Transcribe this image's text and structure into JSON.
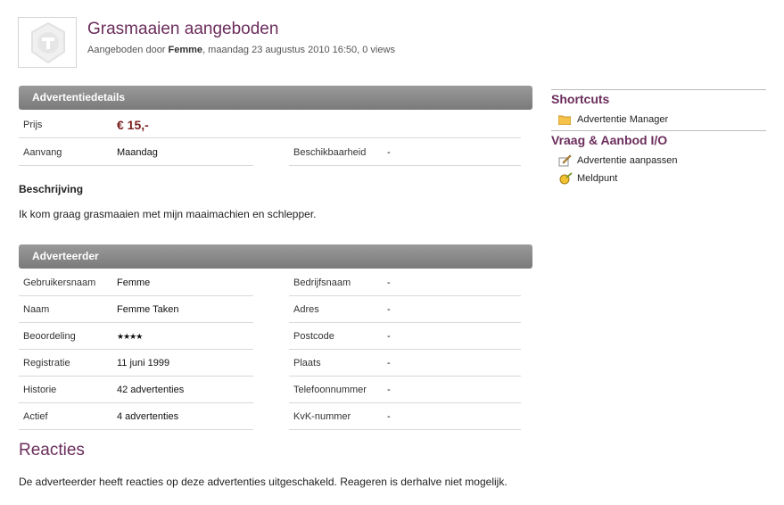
{
  "header": {
    "title": "Grasmaaien aangeboden",
    "subtitle_prefix": "Aangeboden door",
    "author": "Femme",
    "subtitle_suffix": ", maandag 23 augustus 2010 16:50, 0 views"
  },
  "details": {
    "bar_label": "Advertentiedetails",
    "prijs_label": "Prijs",
    "prijs_value": "€ 15,-",
    "aanvang_label": "Aanvang",
    "aanvang_value": "Maandag",
    "beschikbaar_label": "Beschikbaarheid",
    "beschikbaar_value": "-"
  },
  "beschrijving": {
    "heading": "Beschrijving",
    "text": "Ik kom graag grasmaaien met mijn maaimachien en schlepper."
  },
  "adverteerder": {
    "bar_label": "Adverteerder",
    "left": [
      {
        "label": "Gebruikersnaam",
        "value": "Femme",
        "link": true
      },
      {
        "label": "Naam",
        "value": "Femme Taken",
        "link": false
      },
      {
        "label": "Beoordeling",
        "value": "★★★★",
        "link": false,
        "stars": true
      },
      {
        "label": "Registratie",
        "value": "11 juni 1999",
        "link": false
      },
      {
        "label": "Historie",
        "value": "42 advertenties",
        "link": true
      },
      {
        "label": "Actief",
        "value": "4 advertenties",
        "link": true
      }
    ],
    "right": [
      {
        "label": "Bedrijfsnaam",
        "value": "-"
      },
      {
        "label": "Adres",
        "value": "-"
      },
      {
        "label": "Postcode",
        "value": "-"
      },
      {
        "label": "Plaats",
        "value": "-"
      },
      {
        "label": "Telefoonnummer",
        "value": "-"
      },
      {
        "label": "KvK-nummer",
        "value": "-"
      }
    ],
    "rating": 4
  },
  "reacties": {
    "heading": "Reacties",
    "text": "De adverteerder heeft reacties op deze advertenties uitgeschakeld. Reageren is derhalve niet mogelijk."
  },
  "sidebar": {
    "shortcuts_heading": "Shortcuts",
    "shortcut_item": "Advertentie Manager",
    "shortcut_icon": "folder-icon",
    "vraag_heading": "Vraag & Aanbod I/O",
    "edit_item": "Advertentie aanpassen",
    "edit_icon": "edit-icon",
    "report_item": "Meldpunt",
    "report_icon": "report-icon"
  },
  "colors": {
    "accent": "#6b2d5c",
    "link": "#1a7a9a",
    "bar": "#858585",
    "star": "#8cc63f"
  }
}
